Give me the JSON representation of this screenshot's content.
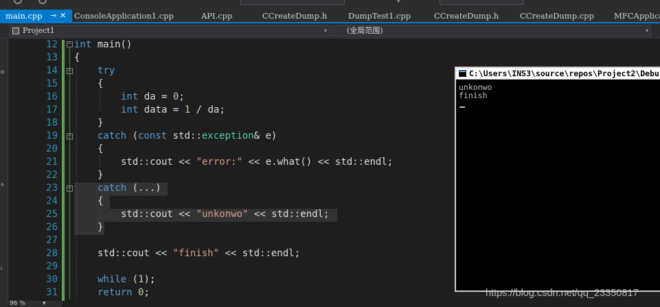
{
  "tabs": [
    {
      "label": "main.cpp",
      "active": true
    },
    {
      "label": "ConsoleApplication1.cpp"
    },
    {
      "label": "API.cpp"
    },
    {
      "label": "CCreateDump.h"
    },
    {
      "label": "DumpTest1.cpp"
    },
    {
      "label": "CCreateDump.h"
    },
    {
      "label": "CCreateDump.cpp"
    },
    {
      "label": "MFCApplica"
    }
  ],
  "active_tab_icons": {
    "pin": "⊸",
    "close": "✕"
  },
  "nav": {
    "project": "Project1",
    "scope": "(全局范围)"
  },
  "line_numbers": [
    "12",
    "13",
    "14",
    "15",
    "16",
    "17",
    "18",
    "19",
    "20",
    "21",
    "22",
    "23",
    "24",
    "25",
    "26",
    "27",
    "28",
    "29",
    "30",
    "31"
  ],
  "code": {
    "l12": {
      "kw": "int",
      "rest": " main()"
    },
    "l13": {
      "text": "{"
    },
    "l14": {
      "kw": "try"
    },
    "l15": {
      "text": "{"
    },
    "l16": {
      "kw": "int",
      "mid": " da = ",
      "num": "0",
      "end": ";"
    },
    "l17": {
      "kw": "int",
      "mid": " data = ",
      "num": "1",
      "end": " / da;"
    },
    "l18": {
      "text": "}"
    },
    "l19": {
      "kw": "catch",
      "a": " (",
      "kw2": "const",
      "b": " std::",
      "type": "exception",
      "c": "& e)"
    },
    "l20": {
      "text": "{"
    },
    "l21": {
      "a": "std::cout << ",
      "str": "\"error:\"",
      "b": " << e.what() << std::endl;"
    },
    "l22": {
      "text": "}"
    },
    "l23": {
      "kw": "catch",
      "rest": " (...)"
    },
    "l24": {
      "text": "{"
    },
    "l25": {
      "a": "std::cout << ",
      "str": "\"unkonwo\"",
      "b": " << std::endl;"
    },
    "l26": {
      "text": "}"
    },
    "l28": {
      "a": "std::cout << ",
      "str": "\"finish\"",
      "b": " << std::endl;"
    },
    "l30": {
      "kw": "while",
      "a": " (",
      "num": "1",
      "b": ");"
    },
    "l31": {
      "kw": "return",
      "a": " ",
      "num": "0",
      "b": ";"
    }
  },
  "console": {
    "title": "C:\\Users\\INS3\\source\\repos\\Project2\\Debu",
    "output": [
      "unkonwo",
      "finish"
    ]
  },
  "status": {
    "zoom": "96 %"
  },
  "watermark": "https://blog.csdn.net/qq_23350817",
  "colors": {
    "accent": "#007acc",
    "keyword": "#569cd6",
    "string": "#d69d85",
    "line_number": "#2b91af",
    "type": "#4ec9b0",
    "change_bar": "#57a64a"
  }
}
